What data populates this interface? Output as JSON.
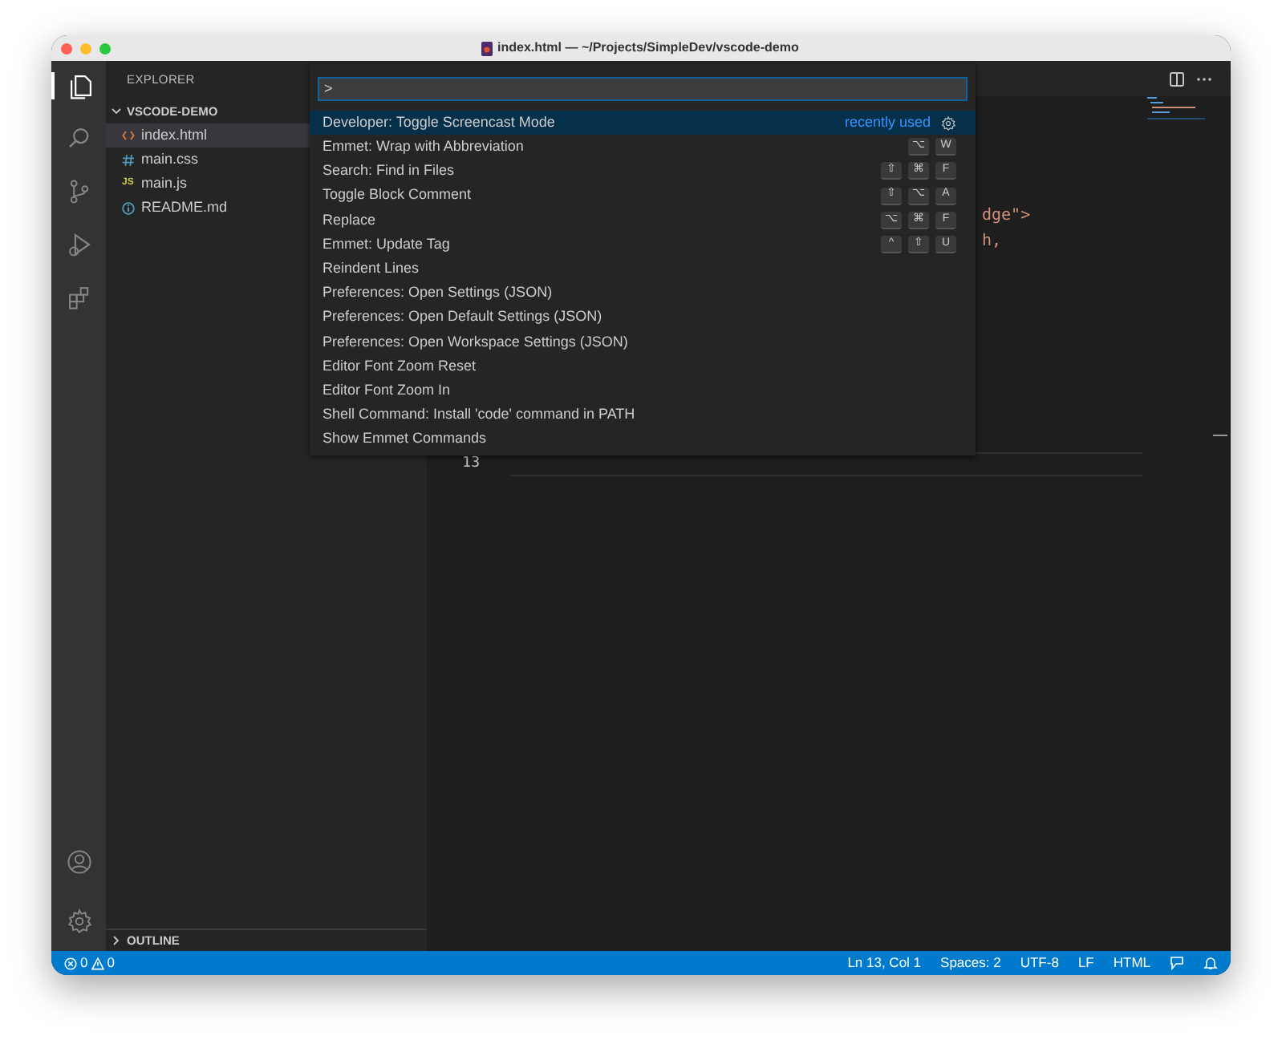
{
  "window": {
    "title": "index.html — ~/Projects/SimpleDev/vscode-demo"
  },
  "activity_bar": {
    "items": [
      {
        "kind": "files",
        "selected": true
      },
      {
        "kind": "search",
        "selected": false
      },
      {
        "kind": "source-control",
        "selected": false
      },
      {
        "kind": "run",
        "selected": false
      },
      {
        "kind": "extensions",
        "selected": false
      }
    ],
    "bottom": [
      {
        "kind": "account"
      },
      {
        "kind": "settings"
      }
    ]
  },
  "sidebar": {
    "title": "EXPLORER",
    "folder": {
      "name": "VSCODE-DEMO",
      "expanded": true,
      "files": [
        {
          "name": "index.html",
          "kind": "html",
          "selected": true
        },
        {
          "name": "main.css",
          "kind": "css",
          "selected": false
        },
        {
          "name": "main.js",
          "kind": "js",
          "glyph": "JS",
          "selected": false
        },
        {
          "name": "README.md",
          "kind": "markdown",
          "selected": false
        }
      ]
    },
    "outline": {
      "label": "OUTLINE",
      "expanded": false
    }
  },
  "editor": {
    "fragments": [
      "dge\">",
      "h,"
    ],
    "current_line": "13"
  },
  "command_palette": {
    "value": ">",
    "items": [
      {
        "label": "Developer: Toggle Screencast Mode",
        "selected": true,
        "detail": "recently used"
      },
      {
        "label": "Emmet: Wrap with Abbreviation",
        "selected": false,
        "keys": [
          "⌥",
          "W"
        ]
      },
      {
        "label": "Search: Find in Files",
        "selected": false,
        "keys": [
          "⇧",
          "⌘",
          "F"
        ]
      },
      {
        "label": "Toggle Block Comment",
        "selected": false,
        "keys": [
          "⇧",
          "⌥",
          "A"
        ]
      },
      {
        "label": "Replace",
        "selected": false,
        "keys": [
          "⌥",
          "⌘",
          "F"
        ]
      },
      {
        "label": "Emmet: Update Tag",
        "selected": false,
        "keys": [
          "^",
          "⇧",
          "U"
        ]
      },
      {
        "label": "Reindent Lines",
        "selected": false
      },
      {
        "label": "Preferences: Open Settings (JSON)",
        "selected": false
      },
      {
        "label": "Preferences: Open Default Settings (JSON)",
        "selected": false
      },
      {
        "label": "Preferences: Open Workspace Settings (JSON)",
        "selected": false
      },
      {
        "label": "Editor Font Zoom Reset",
        "selected": false
      },
      {
        "label": "Editor Font Zoom In",
        "selected": false
      },
      {
        "label": "Shell Command: Install 'code' command in PATH",
        "selected": false
      },
      {
        "label": "Show Emmet Commands",
        "selected": false
      }
    ]
  },
  "status_bar": {
    "errors": "0",
    "warnings": "0",
    "items": [
      "Ln 13, Col 1",
      "Spaces: 2",
      "UTF-8",
      "LF",
      "HTML"
    ]
  }
}
